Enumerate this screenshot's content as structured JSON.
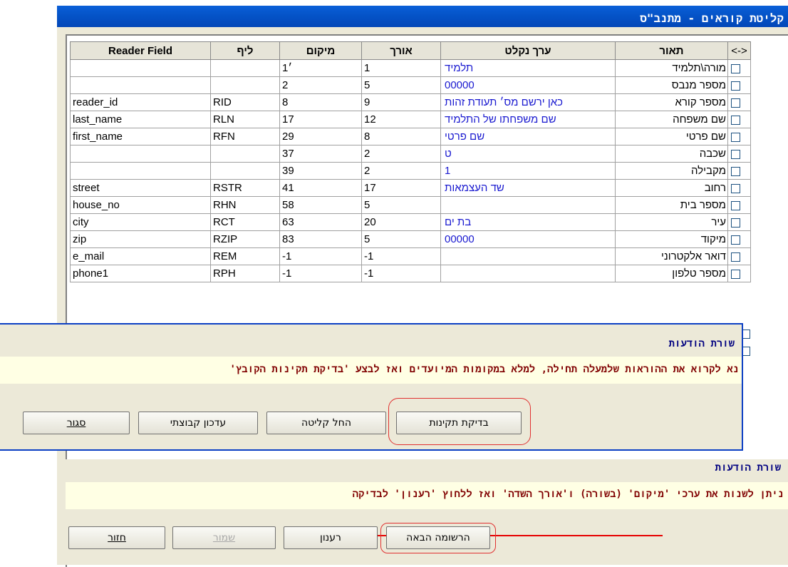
{
  "window": {
    "title": "קליטת קוראים - מתנב\"ס"
  },
  "table": {
    "headers": {
      "select": "<->",
      "description": "תאור",
      "import_value": "ערך נקלט",
      "length": "אורך",
      "position": "מיקום",
      "lif": "ליף",
      "reader_field": "Reader Field"
    },
    "rows": [
      {
        "description": "מורה\\תלמיד",
        "import_value": "תלמיד",
        "length": "1",
        "position": "1׳",
        "lif": "",
        "reader_field": ""
      },
      {
        "description": "מספר מנבס",
        "import_value": "00000",
        "length": "5",
        "position": "2",
        "lif": "",
        "reader_field": ""
      },
      {
        "description": "מספר קורא",
        "import_value": "כאן ירשם מס׳ תעודת זהות",
        "length": "9",
        "position": "8",
        "lif": "RID",
        "reader_field": "reader_id"
      },
      {
        "description": "שם משפחה",
        "import_value": "שם משפחתו של התלמיד",
        "length": "12",
        "position": "17",
        "lif": "RLN",
        "reader_field": "last_name"
      },
      {
        "description": "שם פרטי",
        "import_value": "שם פרטי",
        "length": "8",
        "position": "29",
        "lif": "RFN",
        "reader_field": "first_name"
      },
      {
        "description": "שכבה",
        "import_value": "ט",
        "length": "2",
        "position": "37",
        "lif": "",
        "reader_field": ""
      },
      {
        "description": "מקבילה",
        "import_value": "1",
        "length": "2",
        "position": "39",
        "lif": "",
        "reader_field": ""
      },
      {
        "description": "רחוב",
        "import_value": "שד העצמאות",
        "length": "17",
        "position": "41",
        "lif": "RSTR",
        "reader_field": "street"
      },
      {
        "description": "מספר בית",
        "import_value": "",
        "length": "5",
        "position": "58",
        "lif": "RHN",
        "reader_field": "house_no"
      },
      {
        "description": "עיר",
        "import_value": "בת ים",
        "length": "20",
        "position": "63",
        "lif": "RCT",
        "reader_field": "city"
      },
      {
        "description": "מיקוד",
        "import_value": "00000",
        "length": "5",
        "position": "83",
        "lif": "RZIP",
        "reader_field": "zip"
      },
      {
        "description": "דואר אלקטרוני",
        "import_value": "",
        "length": "-1",
        "position": "-1",
        "lif": "REM",
        "reader_field": "e_mail"
      },
      {
        "description": "מספר טלפון",
        "import_value": "",
        "length": "-1",
        "position": "-1",
        "lif": "RPH",
        "reader_field": "phone1"
      }
    ]
  },
  "dialog": {
    "messages_label": "שורת הודעות",
    "message": "נא לקרוא את ההוראות שלמעלה תחילה, למלא במקומות המיועדים ואז לבצע 'בדיקת תקינות הקובץ'",
    "buttons": {
      "check": "בדיקת תקינות",
      "start_import": "החל קליטה",
      "group_update": "עדכון קבוצתי",
      "close": "סגור"
    }
  },
  "bottom": {
    "messages_label": "שורת הודעות",
    "message": "ניתן לשנות את ערכי 'מיקום' (בשורה) ו'אורך השדה' ואז ללחוץ 'רענון' לבדיקה",
    "buttons": {
      "next_record": "הרשומה הבאה",
      "refresh": "רענון",
      "save": "שמור",
      "back": "חזור"
    }
  },
  "colors": {
    "title_bar": "#0452c6",
    "highlight": "#e03030",
    "strike": "#e60000",
    "message_text": "#800000",
    "value_text": "#1a1ad0"
  }
}
